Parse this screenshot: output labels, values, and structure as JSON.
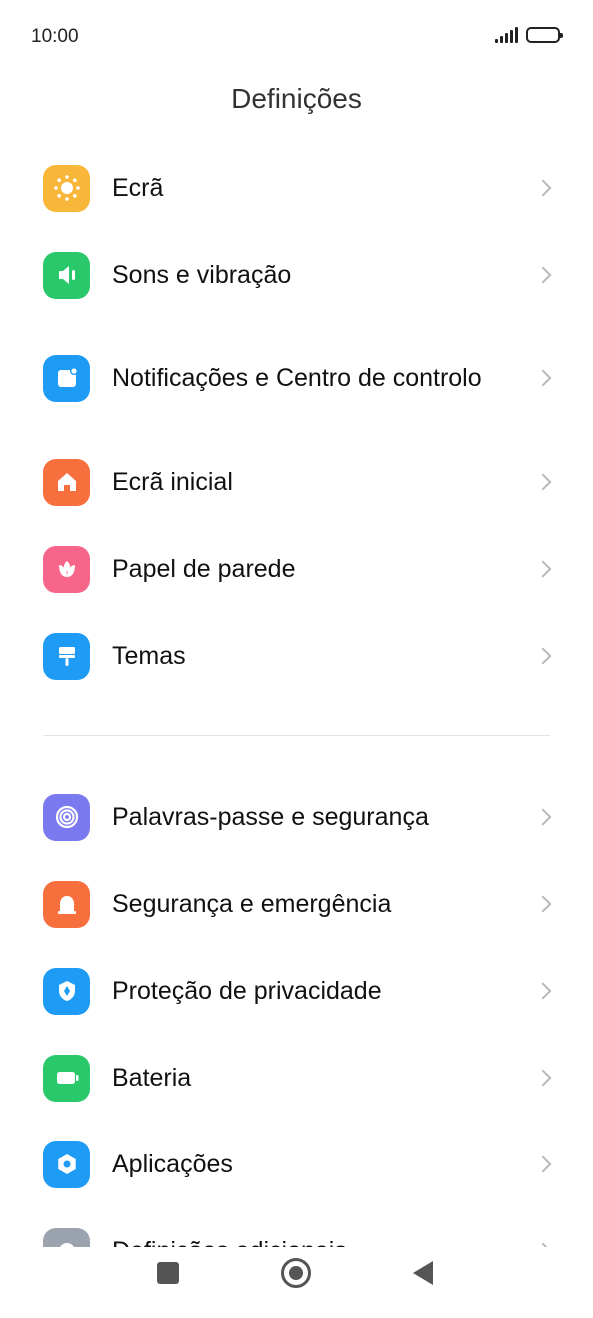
{
  "status_bar": {
    "time": "10:00"
  },
  "header": {
    "title": "Definições"
  },
  "groups": [
    {
      "items": [
        {
          "label": "Ecrã",
          "icon": "sun-icon",
          "color": "#F9B739"
        },
        {
          "label": "Sons e vibração",
          "icon": "speaker-icon",
          "color": "#29C86A"
        },
        {
          "label": "Notificações e Centro de controlo",
          "icon": "notification-icon",
          "color": "#1E9CF5"
        },
        {
          "label": "Ecrã inicial",
          "icon": "home-icon",
          "color": "#F86F3E"
        },
        {
          "label": "Papel de parede",
          "icon": "flower-icon",
          "color": "#F7668A"
        },
        {
          "label": "Temas",
          "icon": "paintbrush-icon",
          "color": "#1E9CF5"
        }
      ]
    },
    {
      "items": [
        {
          "label": "Palavras-passe e segurança",
          "icon": "fingerprint-icon",
          "color": "#7B79F0"
        },
        {
          "label": "Segurança e emergência",
          "icon": "alarm-icon",
          "color": "#F86F3E"
        },
        {
          "label": "Proteção de privacidade",
          "icon": "privacy-icon",
          "color": "#1E9CF5"
        },
        {
          "label": "Bateria",
          "icon": "battery-icon",
          "color": "#29C86A"
        },
        {
          "label": "Aplicações",
          "icon": "gear-icon",
          "color": "#1E9CF5"
        },
        {
          "label": "Definições adicionais",
          "icon": "more-settings-icon",
          "color": "#9AA3AE"
        }
      ]
    }
  ]
}
